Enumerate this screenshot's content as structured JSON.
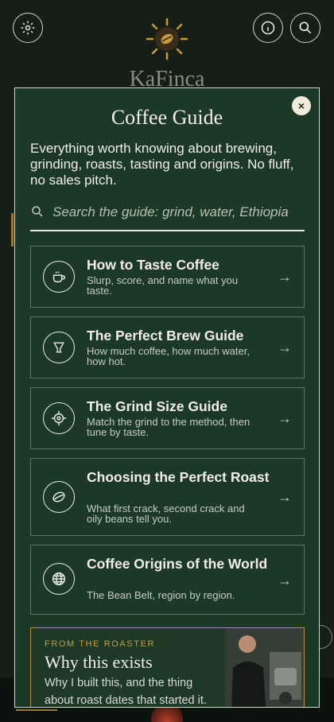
{
  "app": {
    "brand": "KaFinca"
  },
  "modal": {
    "title": "Coffee Guide",
    "intro": "Everything worth knowing about brewing, grinding, roasts, tasting and origins. No fluff, no sales pitch.",
    "close_label": "×",
    "search": {
      "placeholder": "Search the guide: grind, water, Ethiopia",
      "value": ""
    },
    "guides": [
      {
        "title": "How to Taste Coffee",
        "description": "Slurp, score, and name what you taste.",
        "icon": "cup-icon"
      },
      {
        "title": "The Perfect Brew Guide",
        "description": "How much coffee, how much water, how hot.",
        "icon": "dripper-icon"
      },
      {
        "title": "The Grind Size Guide",
        "description": "Match the grind to the method, then tune by taste.",
        "icon": "target-icon"
      },
      {
        "title": "Choosing the Perfect Roast",
        "description": "What first crack, second crack and oily beans tell you.",
        "icon": "coffee-bean-icon"
      },
      {
        "title": "Coffee Origins of the World",
        "description": "The Bean Belt, region by region.",
        "icon": "globe-icon"
      }
    ],
    "arrow": "→",
    "roaster": {
      "kicker": "FROM THE ROASTER",
      "title": "Why this exists",
      "text": "Why I built this, and the thing about roast dates that started it."
    }
  },
  "colors": {
    "background": "#151f17",
    "modal": "#1c3826",
    "accent_gold": "#c89a3e",
    "text": "#f3efe4"
  }
}
